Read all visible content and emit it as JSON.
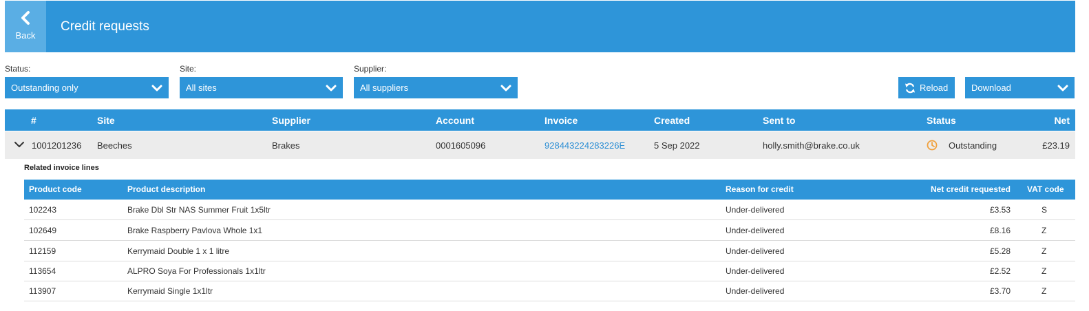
{
  "header": {
    "back_label": "Back",
    "title": "Credit requests"
  },
  "filters": {
    "status": {
      "label": "Status:",
      "value": "Outstanding only"
    },
    "site": {
      "label": "Site:",
      "value": "All sites"
    },
    "supplier": {
      "label": "Supplier:",
      "value": "All suppliers"
    }
  },
  "toolbar": {
    "reload_label": "Reload",
    "download_label": "Download"
  },
  "grid": {
    "columns": [
      "#",
      "Site",
      "Supplier",
      "Account",
      "Invoice",
      "Created",
      "Sent to",
      "Status",
      "Net"
    ],
    "row": {
      "number": "1001201236",
      "site": "Beeches",
      "supplier": "Brakes",
      "account": "0001605096",
      "invoice": "928443224283226E",
      "created": "5 Sep 2022",
      "sent_to": "holly.smith@brake.co.uk",
      "status": "Outstanding",
      "net": "£23.19"
    }
  },
  "related": {
    "title": "Related invoice lines",
    "columns": [
      "Product code",
      "Product description",
      "Reason for credit",
      "Net credit requested",
      "VAT code"
    ],
    "rows": [
      {
        "code": "102243",
        "description": "Brake Dbl Str NAS Summer Fruit 1x5ltr",
        "reason": "Under-delivered",
        "net": "£3.53",
        "vat": "S"
      },
      {
        "code": "102649",
        "description": "Brake Raspberry Pavlova Whole 1x1",
        "reason": "Under-delivered",
        "net": "£8.16",
        "vat": "Z"
      },
      {
        "code": "112159",
        "description": "Kerrymaid Double 1 x 1 litre",
        "reason": "Under-delivered",
        "net": "£5.28",
        "vat": "Z"
      },
      {
        "code": "113654",
        "description": "ALPRO Soya For Professionals 1x1ltr",
        "reason": "Under-delivered",
        "net": "£2.52",
        "vat": "Z"
      },
      {
        "code": "113907",
        "description": "Kerrymaid Single 1x1ltr",
        "reason": "Under-delivered",
        "net": "£3.70",
        "vat": "Z"
      }
    ]
  },
  "colors": {
    "primary": "#2e95d9",
    "back_button": "#5aaee4",
    "row_background": "#ececec",
    "link": "#2e8fd4",
    "status_icon": "#f0a03c"
  },
  "icons": {
    "back": "chevron-left-icon",
    "select": "chevron-down-icon",
    "reload": "refresh-icon",
    "expand": "chevron-down-icon",
    "status": "clock-icon"
  }
}
